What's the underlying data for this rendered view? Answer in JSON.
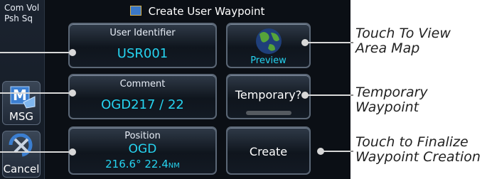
{
  "sidebar": {
    "com_vol": "Com Vol",
    "psh_sq": "Psh Sq",
    "msg_label": "MSG",
    "cancel_label": "Cancel"
  },
  "header": {
    "title": "Create User Waypoint"
  },
  "buttons": {
    "user_identifier": {
      "label": "User Identifier",
      "value": "USR001"
    },
    "comment": {
      "label": "Comment",
      "value": "OGD217 / 22"
    },
    "position": {
      "label": "Position",
      "airport": "OGD",
      "bearing": "216.6°",
      "distance": "22.4",
      "unit": "NM"
    },
    "preview": {
      "label": "Preview"
    },
    "temporary": {
      "label": "Temporary?"
    },
    "create": {
      "label": "Create"
    }
  },
  "callouts": {
    "preview_1": "Touch To View",
    "preview_2": "Area Map",
    "temporary_1": "Temporary",
    "temporary_2": "Waypoint",
    "create_1": "Touch to Finalize",
    "create_2": "Waypoint Creation"
  },
  "colors": {
    "value_text": "#26d4f0",
    "screen_bg": "#0b0f15",
    "annunciator_off": "#555a60"
  }
}
